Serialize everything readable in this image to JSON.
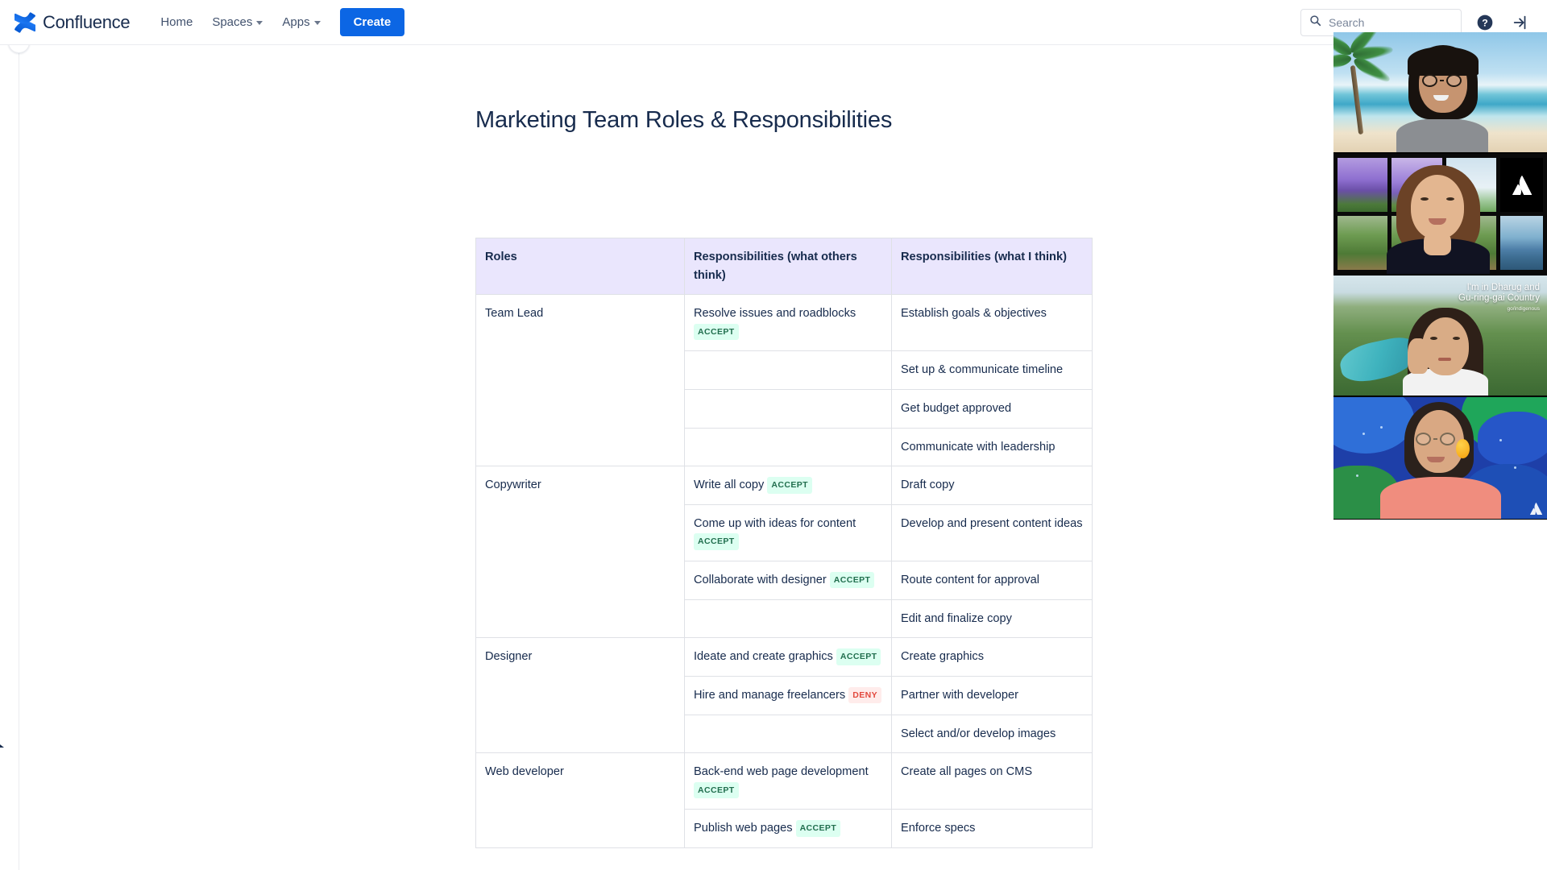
{
  "app": {
    "brand_name": "Confluence",
    "brand_icon": "confluence-logo-icon"
  },
  "topnav": {
    "items": [
      {
        "label": "Home",
        "has_chevron": false
      },
      {
        "label": "Spaces",
        "has_chevron": true
      },
      {
        "label": "Apps",
        "has_chevron": true
      }
    ],
    "create_label": "Create",
    "search": {
      "placeholder": "Search",
      "value": "",
      "icon": "search-icon"
    },
    "help_icon": "help-circle-icon",
    "signin_icon": "sign-in-arrow-icon"
  },
  "sidebar": {
    "expand_icon": "chevron-right-icon",
    "collapsed": true
  },
  "page": {
    "title": "Marketing Team Roles & Responsibilities"
  },
  "table": {
    "headers": [
      "Roles",
      "Responsibilities (what others think)",
      "Responsibilities (what I think)"
    ],
    "rows": [
      {
        "role": "Team Lead",
        "row_count": 4,
        "lines": [
          {
            "others": "Resolve issues and roadblocks",
            "others_badge": "ACCEPT",
            "others_badge_type": "accept",
            "mine": "Establish goals & objectives"
          },
          {
            "others": "",
            "others_badge": "",
            "others_badge_type": "",
            "mine": "Set up & communicate timeline"
          },
          {
            "others": "",
            "others_badge": "",
            "others_badge_type": "",
            "mine": "Get budget approved"
          },
          {
            "others": "",
            "others_badge": "",
            "others_badge_type": "",
            "mine": "Communicate with leadership"
          }
        ]
      },
      {
        "role": "Copywriter",
        "row_count": 4,
        "lines": [
          {
            "others": "Write all copy",
            "others_badge": "ACCEPT",
            "others_badge_type": "accept",
            "mine": "Draft copy"
          },
          {
            "others": "Come up with ideas for content",
            "others_badge": "ACCEPT",
            "others_badge_type": "accept",
            "mine": "Develop and present content ideas"
          },
          {
            "others": "Collaborate with designer",
            "others_badge": "ACCEPT",
            "others_badge_type": "accept",
            "mine": "Route content for approval"
          },
          {
            "others": "",
            "others_badge": "",
            "others_badge_type": "",
            "mine": "Edit and finalize copy"
          }
        ]
      },
      {
        "role": "Designer",
        "row_count": 3,
        "lines": [
          {
            "others": "Ideate and create graphics",
            "others_badge": "ACCEPT",
            "others_badge_type": "accept",
            "mine": "Create graphics"
          },
          {
            "others": "Hire and manage freelancers",
            "others_badge": "DENY",
            "others_badge_type": "deny",
            "mine": "Partner with developer"
          },
          {
            "others": "",
            "others_badge": "",
            "others_badge_type": "",
            "mine": "Select and/or develop images"
          }
        ]
      },
      {
        "role": "Web developer",
        "row_count": 2,
        "lines": [
          {
            "others": "Back-end web page development",
            "others_badge": "ACCEPT",
            "others_badge_type": "accept",
            "mine": "Create all pages on CMS"
          },
          {
            "others": "Publish web pages",
            "others_badge": "ACCEPT",
            "others_badge_type": "accept",
            "mine": "Enforce specs"
          }
        ]
      }
    ]
  },
  "video_panel": {
    "tiles": [
      {
        "participant": "participant-1",
        "background": "beach-palm-tree",
        "overlay_text": ""
      },
      {
        "participant": "participant-2",
        "background": "jacaranda-window-grid",
        "overlay_text": ""
      },
      {
        "participant": "participant-3",
        "background": "valley-river-landscape",
        "overlay_line1": "I'm in Dharug and",
        "overlay_line2": "Gu-ring-gai Country",
        "overlay_line3": "go/indigenous"
      },
      {
        "participant": "participant-4",
        "background": "abstract-blue-green",
        "overlay_text": ""
      }
    ]
  },
  "colors": {
    "brand_blue": "#0C66E4",
    "header_bg": "#EAE6FD",
    "text": "#172B4D",
    "border": "#DFE1E6",
    "accept_bg": "#DCFFF1",
    "accept_fg": "#216E4E",
    "deny_bg": "#FFECEB",
    "deny_fg": "#E2483D"
  }
}
